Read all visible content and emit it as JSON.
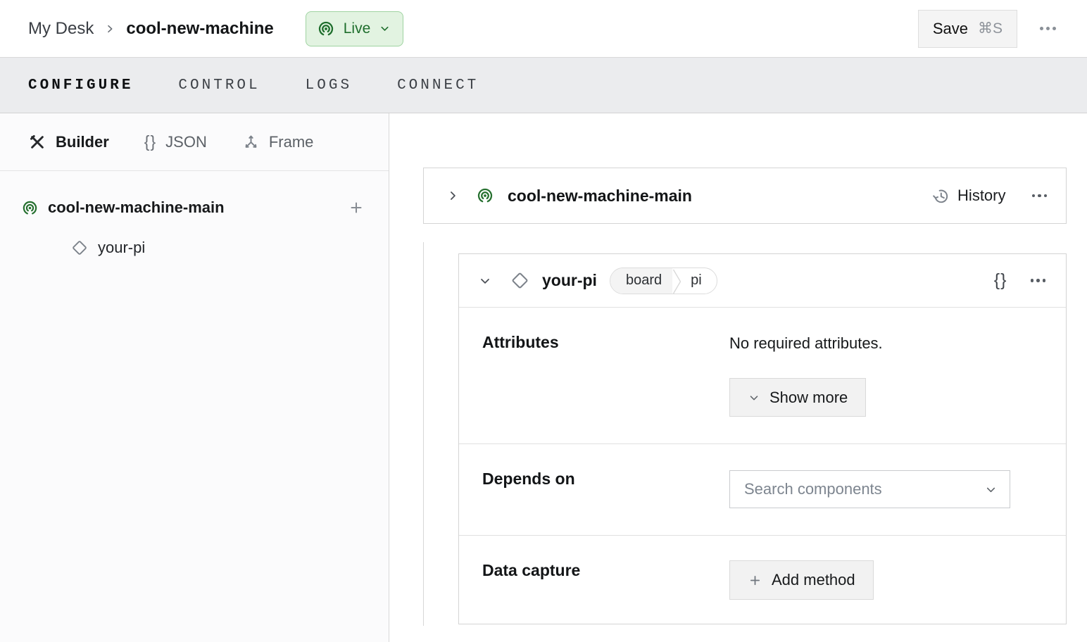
{
  "header": {
    "breadcrumb": {
      "parent": "My Desk",
      "machine": "cool-new-machine"
    },
    "status_badge": {
      "label": "Live"
    },
    "save_button": {
      "label": "Save",
      "shortcut": "⌘S"
    }
  },
  "tabs": [
    {
      "label": "CONFIGURE",
      "active": true
    },
    {
      "label": "CONTROL",
      "active": false
    },
    {
      "label": "LOGS",
      "active": false
    },
    {
      "label": "CONNECT",
      "active": false
    }
  ],
  "sidebar": {
    "modes": [
      {
        "label": "Builder",
        "active": true
      },
      {
        "label": "JSON",
        "active": false
      },
      {
        "label": "Frame",
        "active": false
      }
    ],
    "tree": {
      "root": {
        "label": "cool-new-machine-main"
      },
      "children": [
        {
          "label": "your-pi"
        }
      ]
    }
  },
  "main": {
    "part_card": {
      "title": "cool-new-machine-main",
      "history_label": "History"
    },
    "component_card": {
      "title": "your-pi",
      "type": "board",
      "model": "pi",
      "attributes": {
        "label": "Attributes",
        "empty_text": "No required attributes.",
        "show_more_label": "Show more"
      },
      "depends_on": {
        "label": "Depends on",
        "placeholder": "Search components"
      },
      "data_capture": {
        "label": "Data capture",
        "add_label": "Add method"
      }
    }
  },
  "icons": {
    "braces_glyph": "{}"
  },
  "colors": {
    "accent_green": "#26702f",
    "badge_bg": "#e2f3e1",
    "badge_border": "#9fd3a1",
    "badge_text": "#1e6e2c",
    "tabbar_bg": "#ebecee",
    "card_border": "#d4d4d4",
    "button_bg": "#f2f2f2"
  }
}
